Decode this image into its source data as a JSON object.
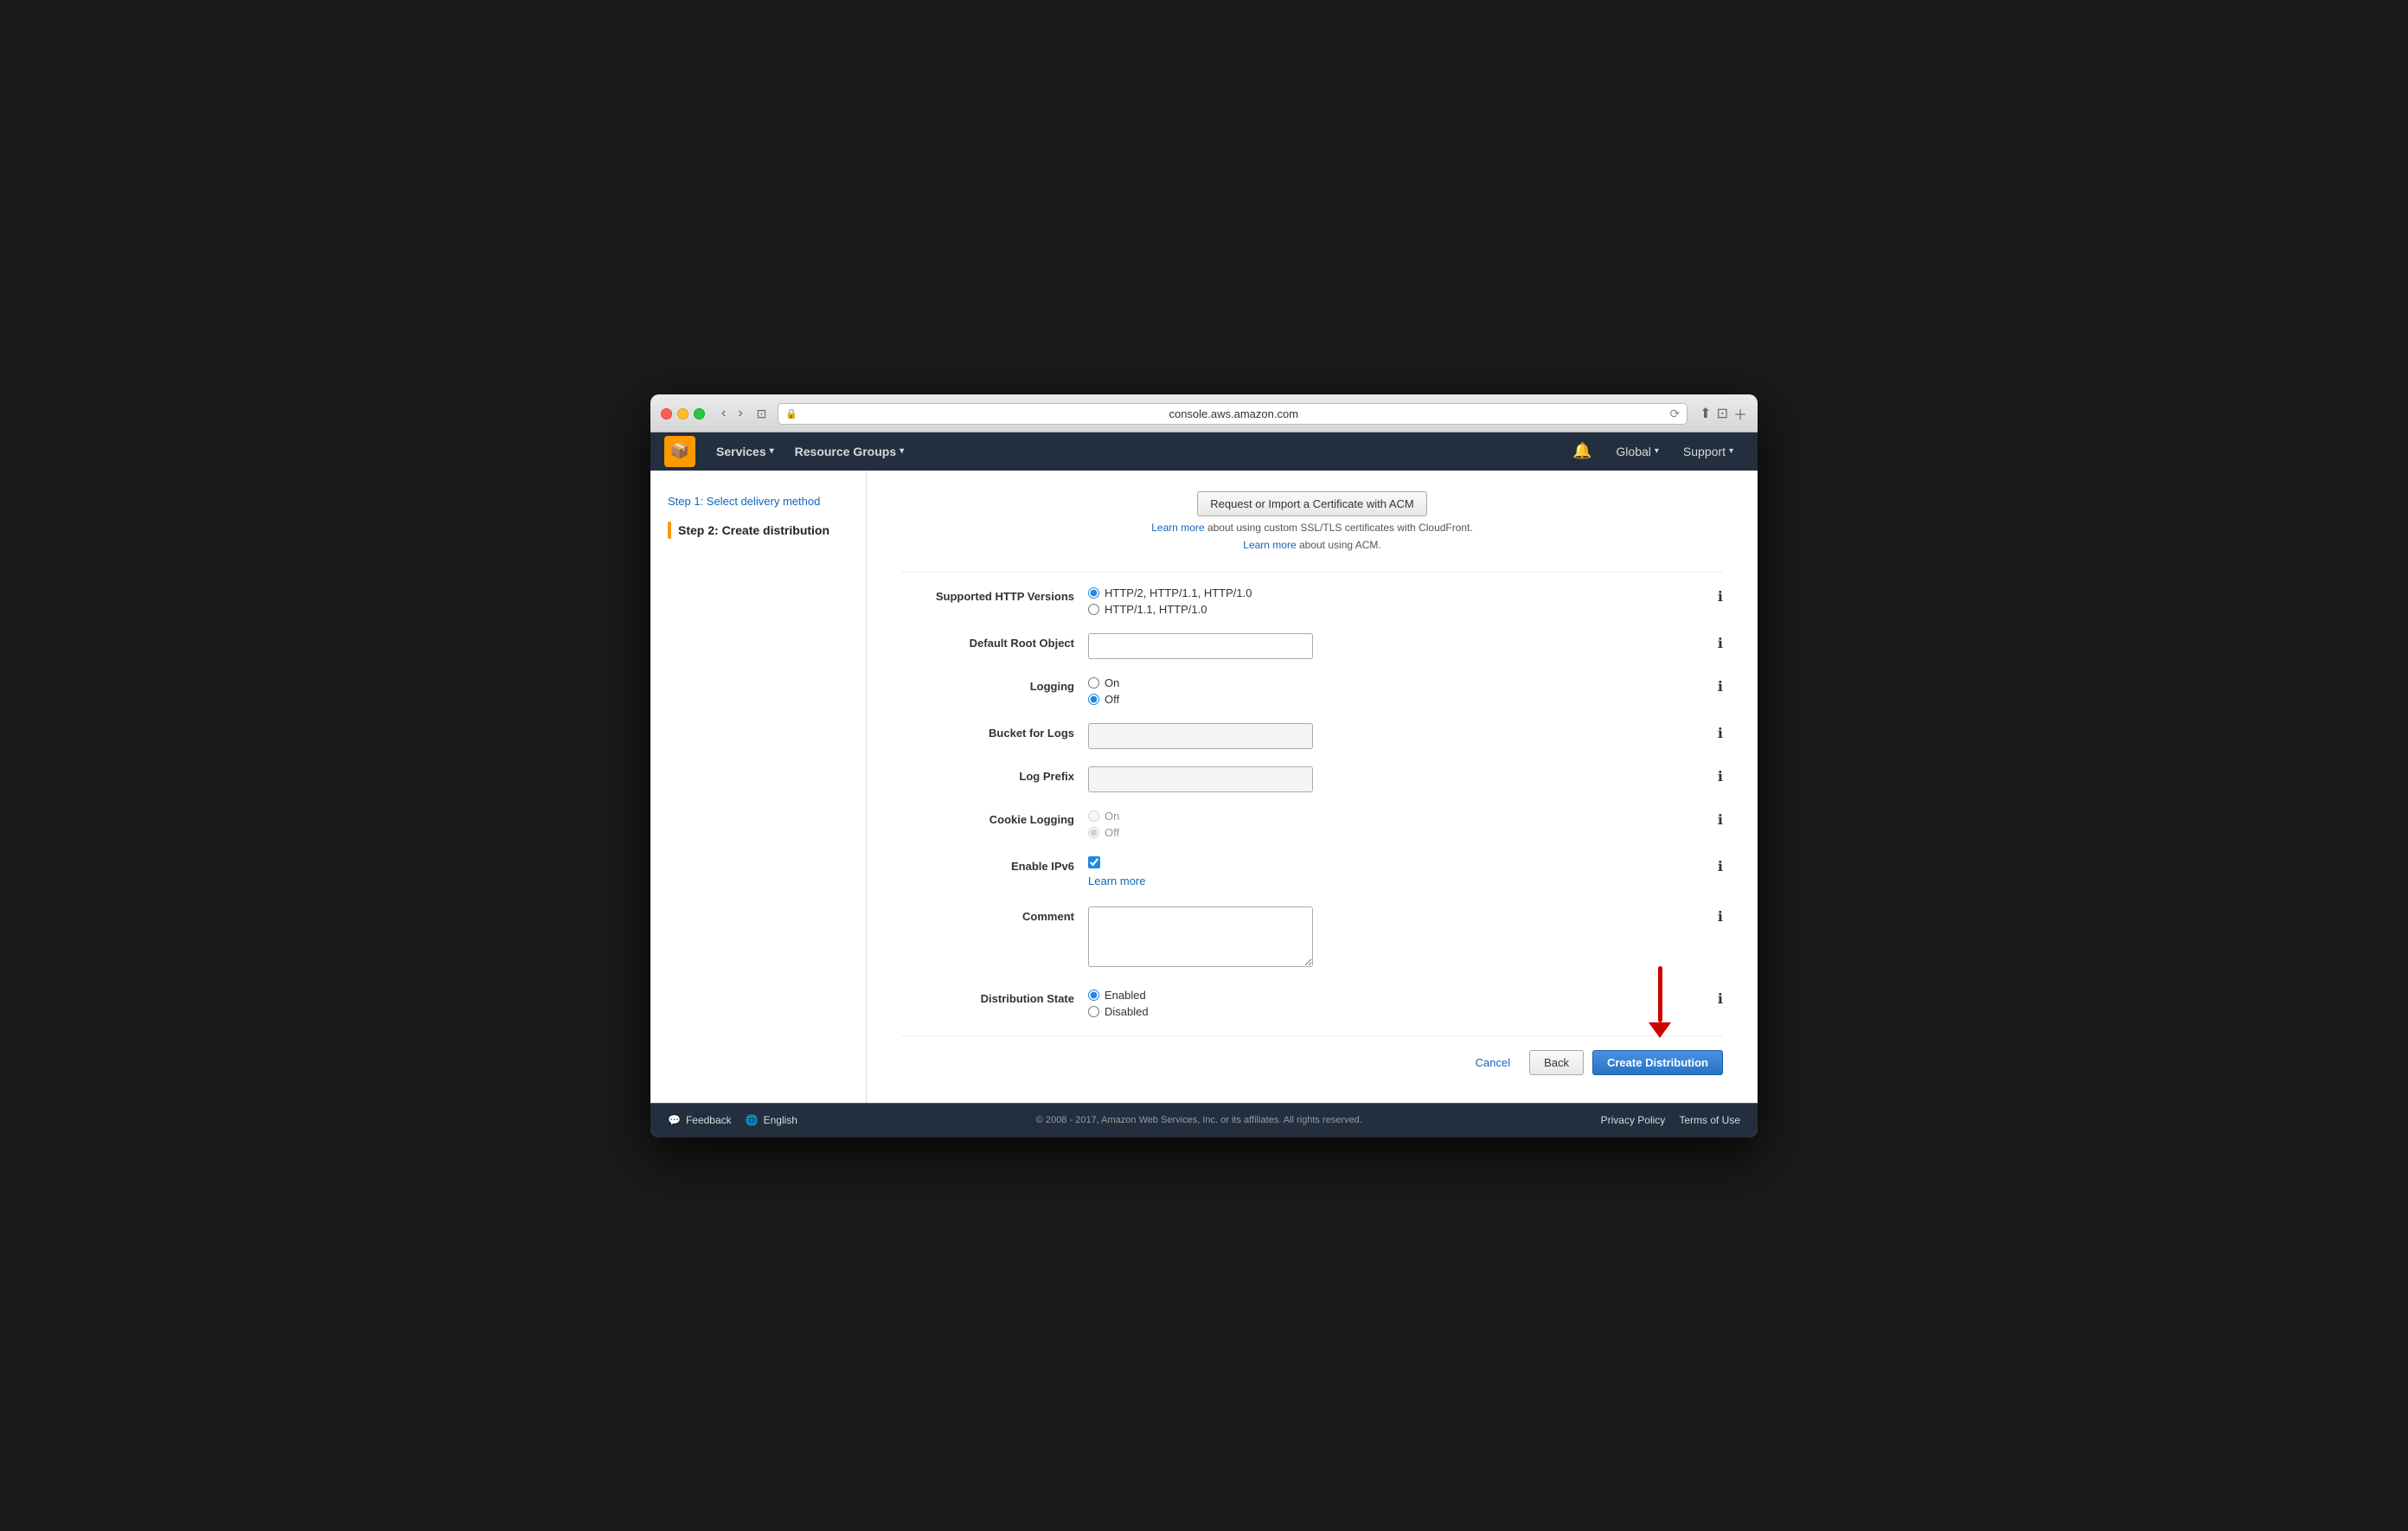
{
  "browser": {
    "address": "console.aws.amazon.com",
    "reload_label": "⟳"
  },
  "nav": {
    "logo": "📦",
    "services_label": "Services",
    "resource_groups_label": "Resource Groups",
    "global_label": "Global",
    "support_label": "Support"
  },
  "sidebar": {
    "step1_label": "Step 1: Select delivery method",
    "step2_label": "Step 2: Create distribution"
  },
  "content": {
    "acm_button_label": "Request or Import a Certificate with ACM",
    "learn_more_ssl": "Learn more",
    "learn_more_acm": "Learn more",
    "ssl_text": " about using custom SSL/TLS certificates with CloudFront.",
    "acm_text": " about using ACM.",
    "http_versions_label": "Supported HTTP Versions",
    "http2_label": "HTTP/2, HTTP/1.1, HTTP/1.0",
    "http11_label": "HTTP/1.1, HTTP/1.0",
    "default_root_label": "Default Root Object",
    "default_root_placeholder": "",
    "logging_label": "Logging",
    "logging_on": "On",
    "logging_off": "Off",
    "bucket_logs_label": "Bucket for Logs",
    "log_prefix_label": "Log Prefix",
    "cookie_logging_label": "Cookie Logging",
    "cookie_on": "On",
    "cookie_off": "Off",
    "enable_ipv6_label": "Enable IPv6",
    "learn_more_ipv6": "Learn more",
    "comment_label": "Comment",
    "dist_state_label": "Distribution State",
    "enabled_label": "Enabled",
    "disabled_label": "Disabled",
    "cancel_label": "Cancel",
    "back_label": "Back",
    "create_label": "Create Distribution"
  },
  "footer": {
    "feedback_label": "Feedback",
    "english_label": "English",
    "copyright": "© 2008 - 2017, Amazon Web Services, Inc. or its affiliates. All rights reserved.",
    "privacy_label": "Privacy Policy",
    "terms_label": "Terms of Use"
  }
}
